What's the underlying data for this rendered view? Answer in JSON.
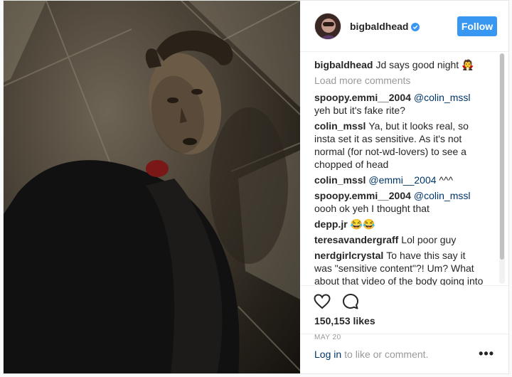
{
  "post": {
    "username": "bigbaldhead",
    "verified_icon": "verified-badge-icon",
    "follow_label": "Follow",
    "photo_icon": "photo-image",
    "caption": {
      "user": "bigbaldhead",
      "text": "Jd says good night 🧛"
    },
    "load_more_label": "Load more comments",
    "comments": [
      {
        "user": "spoopy.emmi__2004",
        "mention": "@colin_mssl",
        "text": " yeh but it's fake rite?"
      },
      {
        "user": "colin_mssl",
        "mention": "",
        "text": "Ya, but it looks real, so insta set it as sensitive. As it's not normal (for not-wd-lovers) to see a chopped of head"
      },
      {
        "user": "colin_mssl",
        "mention": "@emmi__2004",
        "text": " ^^^"
      },
      {
        "user": "spoopy.emmi__2004",
        "mention": "@colin_mssl",
        "text": " oooh ok yeh I thought that"
      },
      {
        "user": "depp.jr",
        "mention": "",
        "text": "😂😂"
      },
      {
        "user": "teresavandergraff",
        "mention": "",
        "text": "Lol poor guy"
      },
      {
        "user": "nerdgirlcrystal",
        "mention": "",
        "text": "To have this say it was \"sensitive content\"?! Um? What about that video of the body going into a hole?! That was creepy af BUT you know what, Norman is always a fan of many things of fx makeup or movie videos from people's"
      }
    ],
    "likes": "150,153 likes",
    "date": "MAY 20",
    "login_link": "Log in",
    "login_rest": "to like or comment.",
    "more_label": "•••",
    "accent_color": "#3897f0"
  }
}
